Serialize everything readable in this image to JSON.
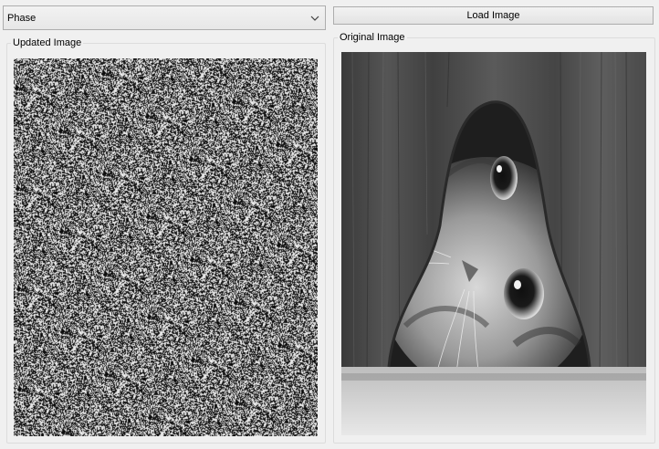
{
  "toolbar": {
    "mode_select": {
      "selected": "Phase"
    },
    "load_button_label": "Load Image"
  },
  "panels": {
    "updated": {
      "title": "Updated Image",
      "content": "phase-noise-image"
    },
    "original": {
      "title": "Original Image",
      "content": "grayscale-photo-kitten-peeking-through-wooden-hole"
    }
  }
}
